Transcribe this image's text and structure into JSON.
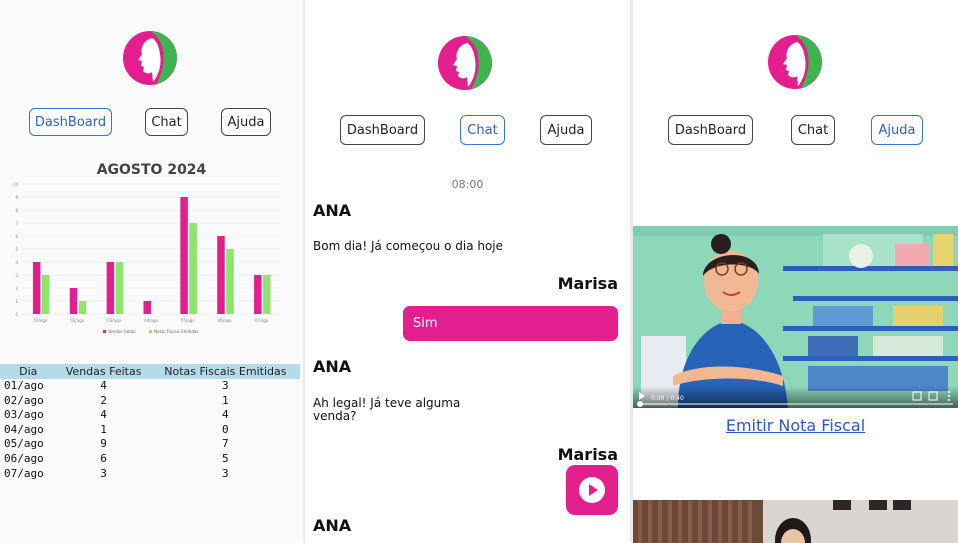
{
  "nav": {
    "dashboard": "DashBoard",
    "chat": "Chat",
    "ajuda": "Ajuda"
  },
  "colors": {
    "brand_pink": "#e21f8d",
    "brand_green": "#3fb34f",
    "table_header": "#b5dbe8",
    "link": "#2b55d4"
  },
  "dashboard": {
    "chart_title": "AGOSTO 2024",
    "table": {
      "headers": [
        "Dia",
        "Vendas Feitas",
        "Notas Fiscais Emitidas"
      ],
      "rows": [
        [
          "01/ago",
          "4",
          "3"
        ],
        [
          "02/ago",
          "2",
          "1"
        ],
        [
          "03/ago",
          "4",
          "4"
        ],
        [
          "04/ago",
          "1",
          "0"
        ],
        [
          "05/ago",
          "9",
          "7"
        ],
        [
          "06/ago",
          "6",
          "5"
        ],
        [
          "07/ago",
          "3",
          "3"
        ]
      ]
    }
  },
  "chart_data": {
    "type": "bar",
    "title": "AGOSTO 2024",
    "categories": [
      "01/ago",
      "02/ago",
      "03/ago",
      "04/ago",
      "05/ago",
      "06/ago",
      "07/ago"
    ],
    "series": [
      {
        "name": "Vendas Feitas",
        "values": [
          4,
          2,
          4,
          1,
          9,
          6,
          3
        ],
        "color": "#e21f8d"
      },
      {
        "name": "Notas Fiscais Emitidas",
        "values": [
          3,
          1,
          4,
          0,
          7,
          5,
          3
        ],
        "color": "#8fe36f"
      }
    ],
    "ylim": [
      0,
      10
    ],
    "yticks": [
      "0",
      "1",
      "2",
      "3",
      "4",
      "5",
      "6",
      "7",
      "8",
      "9",
      "10"
    ],
    "grid": true,
    "legend": "bottom"
  },
  "chat": {
    "time": "08:00",
    "messages": [
      {
        "sender": "ANA",
        "text": "Bom dia! Já começou o dia hoje"
      },
      {
        "sender": "Marisa",
        "text": "Sim"
      },
      {
        "sender": "ANA",
        "text": "Ah legal! Já teve alguma venda?"
      },
      {
        "sender": "Marisa",
        "text": ""
      },
      {
        "sender": "ANA",
        "text": ""
      }
    ]
  },
  "help": {
    "video_link": "Emitir Nota Fiscal",
    "video_time": "0:00 / 0:40"
  }
}
